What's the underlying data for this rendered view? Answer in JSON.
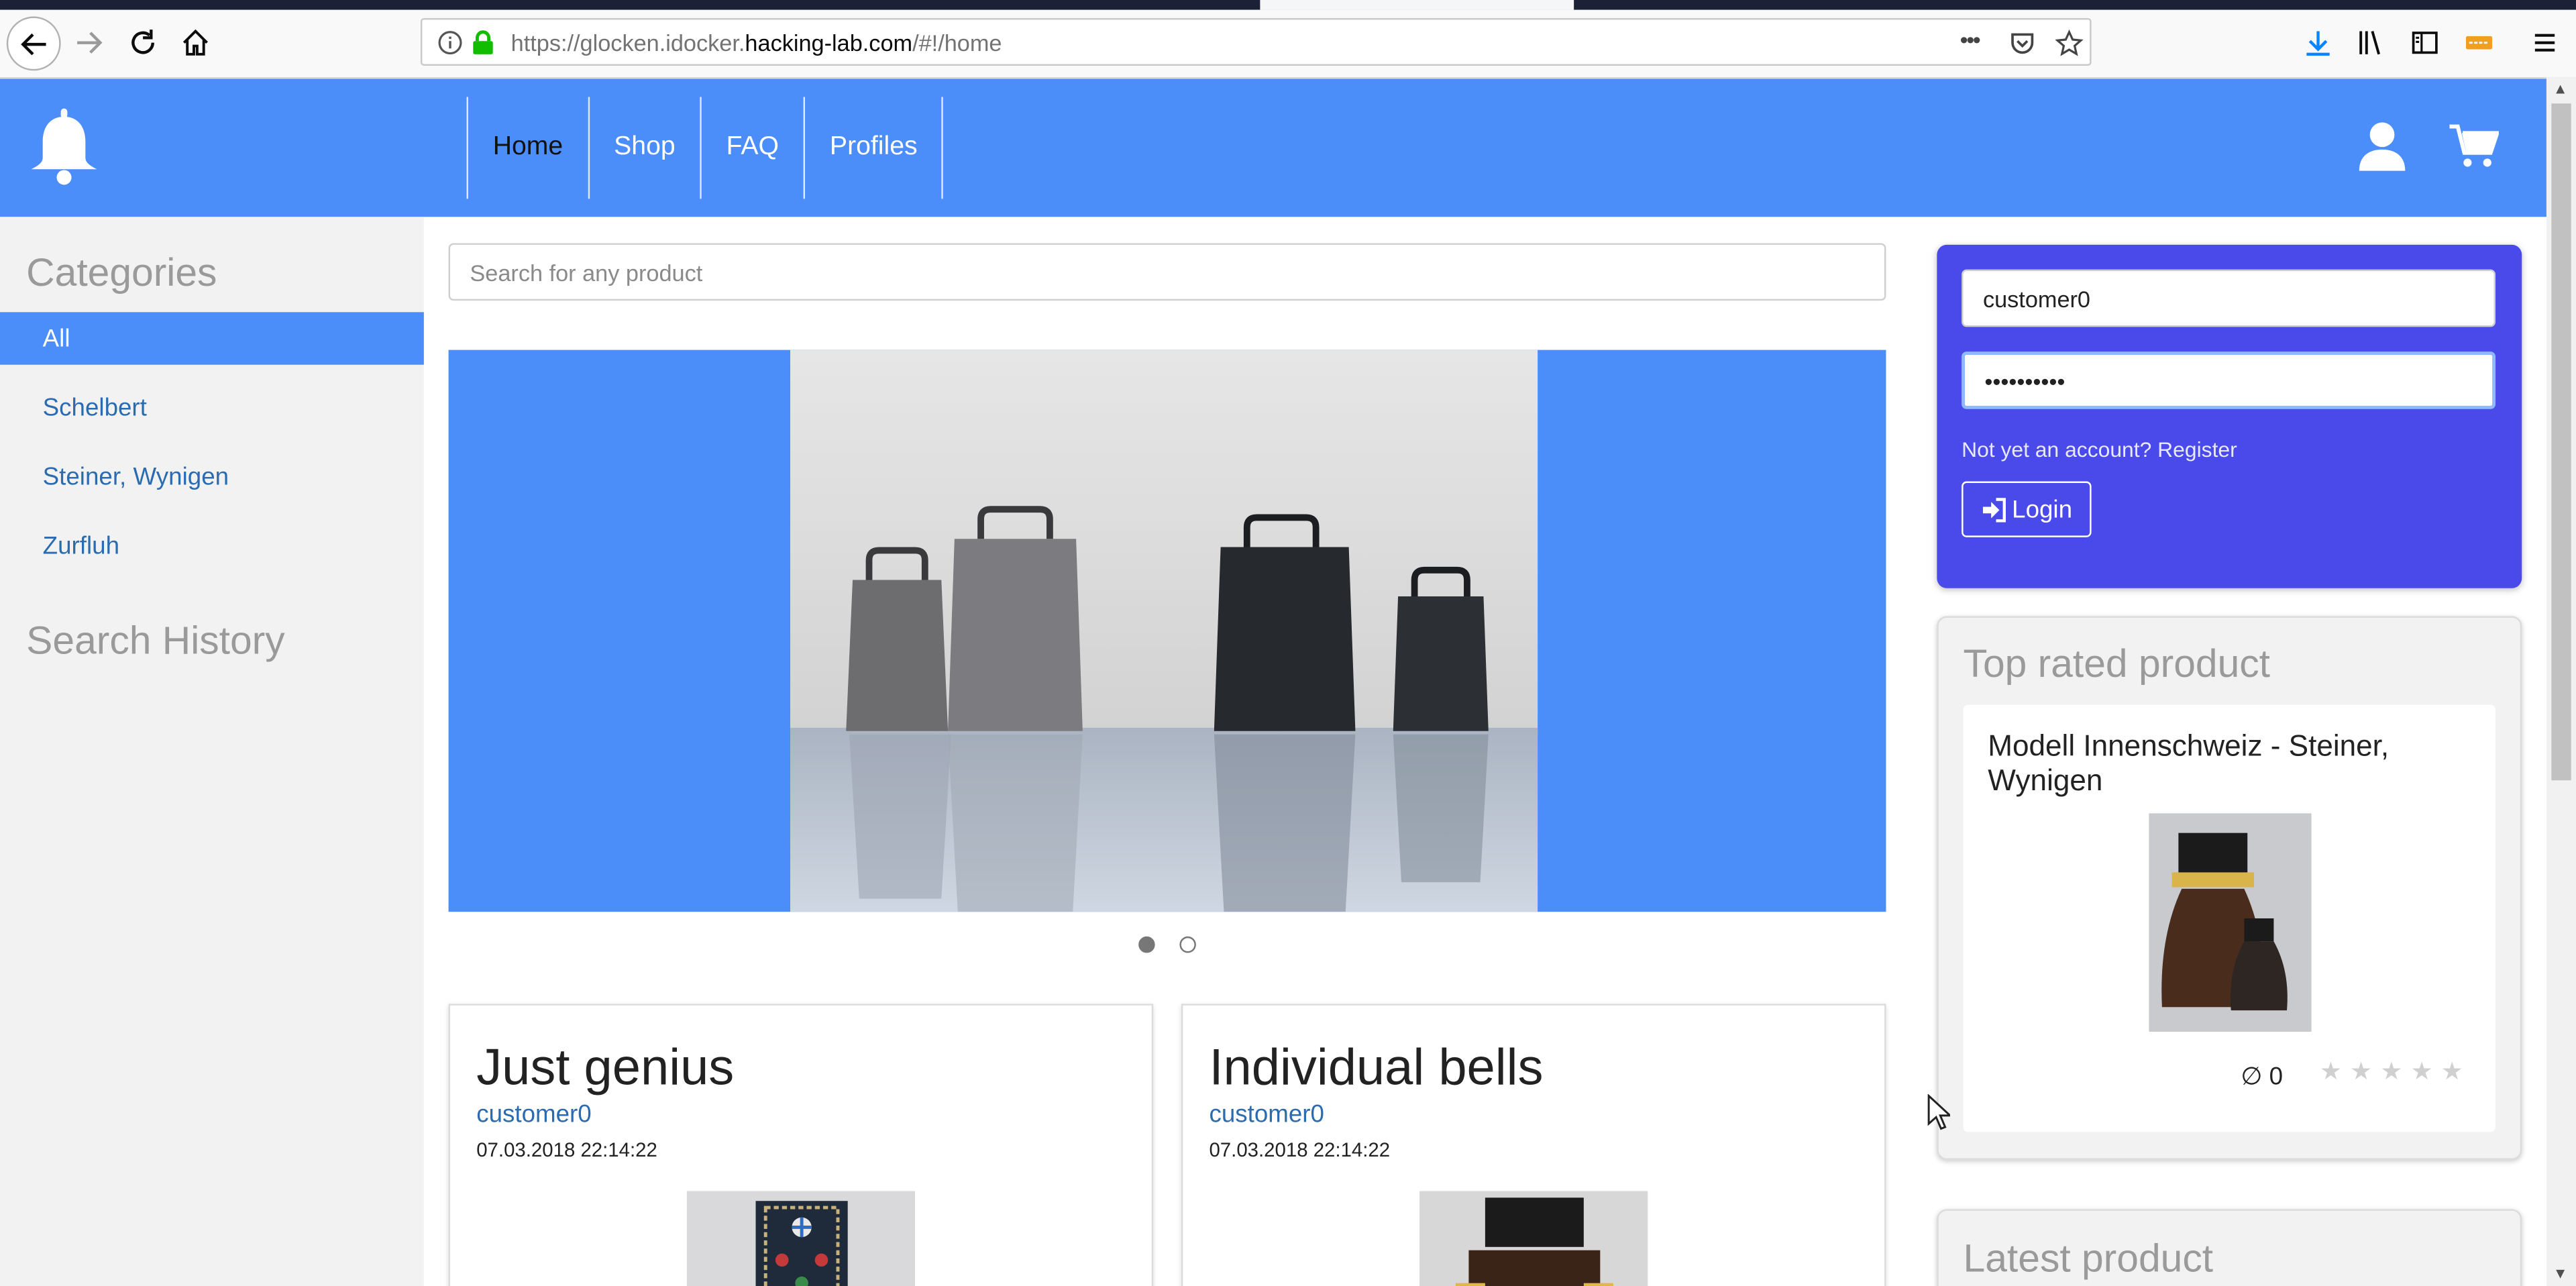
{
  "browser": {
    "url_prefix": "https://glocken.idocker.",
    "url_host": "hacking-lab.com",
    "url_suffix": "/#!/home",
    "more_glyph": "•••"
  },
  "nav": {
    "items": [
      {
        "label": "Home",
        "active": true
      },
      {
        "label": "Shop",
        "active": false
      },
      {
        "label": "FAQ",
        "active": false
      },
      {
        "label": "Profiles",
        "active": false
      }
    ]
  },
  "sidebar": {
    "categories_heading": "Categories",
    "categories": [
      "All",
      "Schelbert",
      "Steiner, Wynigen",
      "Zurfluh"
    ],
    "active_category": "All",
    "search_history_heading": "Search History"
  },
  "search": {
    "placeholder": "Search for any product",
    "value": ""
  },
  "carousel": {
    "slide_count": 2,
    "active_slide": 1
  },
  "cards": [
    {
      "title": "Just genius",
      "author": "customer0",
      "date": "07.03.2018 22:14:22"
    },
    {
      "title": "Individual bells",
      "author": "customer0",
      "date": "07.03.2018 22:14:22"
    }
  ],
  "login": {
    "username": "customer0",
    "password_masked": "••••••••••",
    "register_prefix": "Not yet an account?",
    "register_link": "Register",
    "button_label": "Login"
  },
  "top_rated": {
    "heading": "Top rated product",
    "product_name": "Modell Innenschweiz - Steiner, Wynigen",
    "rating_avg": "∅ 0",
    "stars_filled": 0,
    "stars_total": 5
  },
  "latest": {
    "heading": "Latest product"
  },
  "colors": {
    "brand_blue": "#4b8ef9",
    "login_panel": "#4a49ea",
    "link": "#2b6cb0"
  }
}
